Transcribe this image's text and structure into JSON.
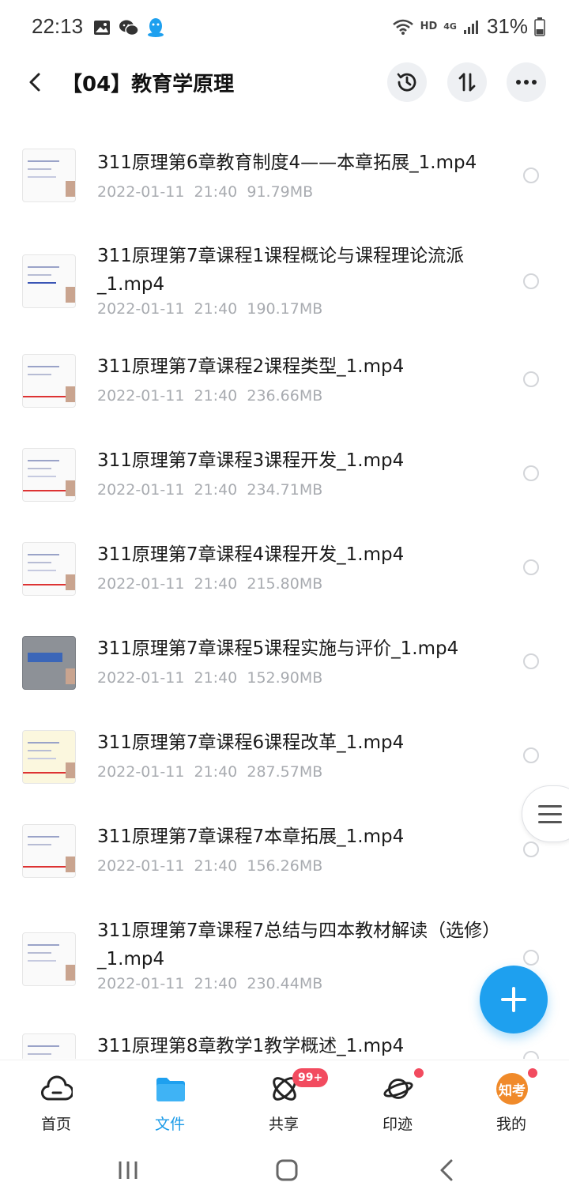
{
  "status": {
    "time": "22:13",
    "hd": "HD",
    "network": "4G",
    "battery": "31%"
  },
  "header": {
    "title": "【04】教育学原理"
  },
  "files": [
    {
      "name": "311原理第6章教育制度4——本章拓展_1.mp4",
      "date": "2022-01-11  21:40",
      "size": "91.79MB"
    },
    {
      "name": "311原理第7章课程1课程概论与课程理论流派_1.mp4",
      "date": "2022-01-11  21:40",
      "size": "190.17MB"
    },
    {
      "name": "311原理第7章课程2课程类型_1.mp4",
      "date": "2022-01-11  21:40",
      "size": "236.66MB"
    },
    {
      "name": "311原理第7章课程3课程开发_1.mp4",
      "date": "2022-01-11  21:40",
      "size": "234.71MB"
    },
    {
      "name": "311原理第7章课程4课程开发_1.mp4",
      "date": "2022-01-11  21:40",
      "size": "215.80MB"
    },
    {
      "name": "311原理第7章课程5课程实施与评价_1.mp4",
      "date": "2022-01-11  21:40",
      "size": "152.90MB"
    },
    {
      "name": "311原理第7章课程6课程改革_1.mp4",
      "date": "2022-01-11  21:40",
      "size": "287.57MB"
    },
    {
      "name": "311原理第7章课程7本章拓展_1.mp4",
      "date": "2022-01-11  21:40",
      "size": "156.26MB"
    },
    {
      "name": "311原理第7章课程7总结与四本教材解读（选修）_1.mp4",
      "date": "2022-01-11  21:40",
      "size": "230.44MB"
    },
    {
      "name": "311原理第8章教学1教学概述_1.mp4",
      "date": "",
      "size": ""
    }
  ],
  "bottom_nav": {
    "home": "首页",
    "files": "文件",
    "share": "共享",
    "share_badge": "99+",
    "trace": "印迹",
    "mine": "我的",
    "avatar_text": "知考"
  },
  "colors": {
    "accent": "#1ea0ef",
    "badge": "#f24b5f",
    "meta_text": "#a8abb0"
  }
}
